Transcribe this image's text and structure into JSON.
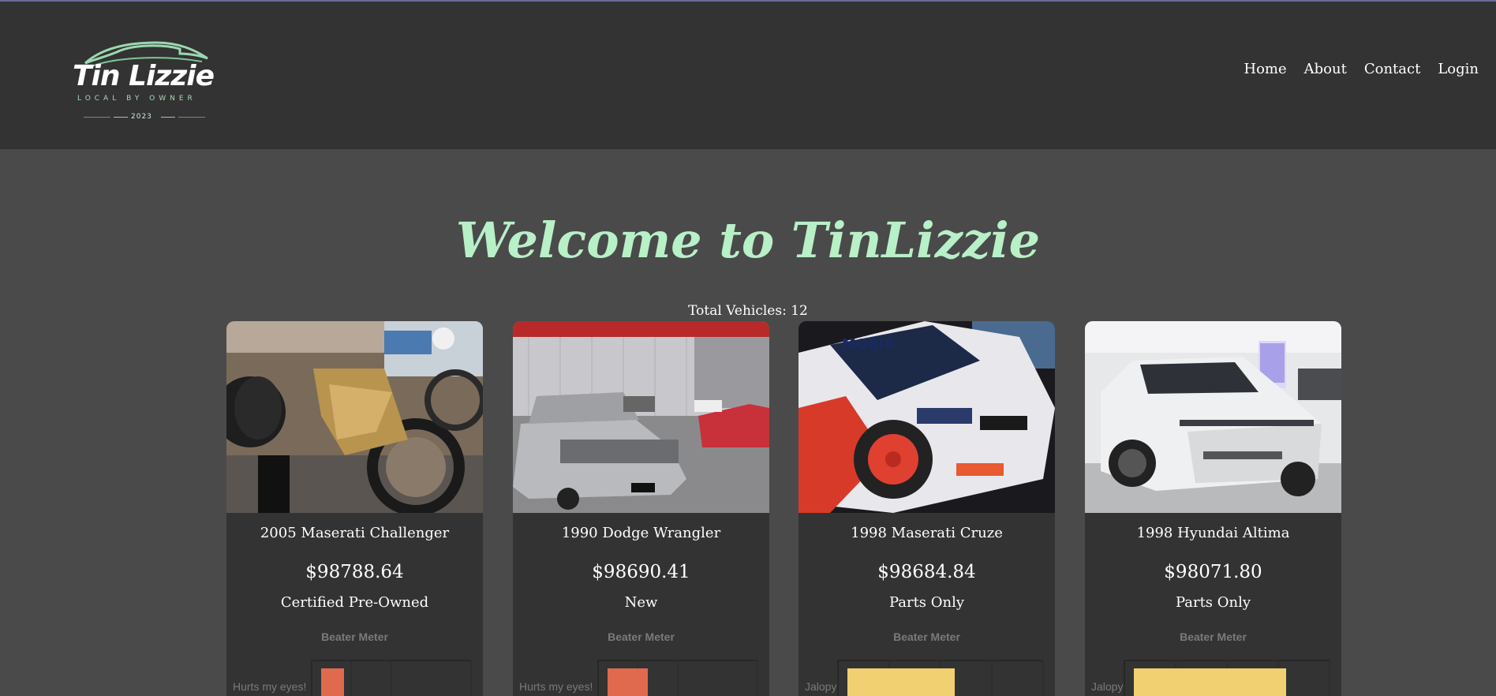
{
  "header": {
    "logo": {
      "name": "Tin Lizzie",
      "tagline": "LOCAL BY OWNER",
      "year": "2023"
    },
    "nav": [
      "Home",
      "About",
      "Contact",
      "Login"
    ]
  },
  "main": {
    "title": "Welcome to TinLizzie",
    "total": "Total Vehicles: 12"
  },
  "colors": {
    "accent": "#b8f0c8",
    "header_bg": "#333333",
    "page_bg": "#4a4a4a",
    "bar_red": "#e06a4e",
    "bar_yellow": "#f0d070"
  },
  "vehicles": [
    {
      "title": "2005 Maserati Challenger",
      "price": "$98788.64",
      "condition": "Certified Pre-Owned",
      "meter_title": "Beater Meter",
      "meter_label": "Hurts my eyes!",
      "meter_level": 0.15,
      "meter_color": "#e06a4e",
      "photo": "motorcycles-photo"
    },
    {
      "title": "1990 Dodge Wrangler",
      "price": "$98690.41",
      "condition": "New",
      "meter_title": "Beater Meter",
      "meter_label": "Hurts my eyes!",
      "meter_level": 0.27,
      "meter_color": "#e06a4e",
      "photo": "classic-sedan-photo"
    },
    {
      "title": "1998 Maserati Cruze",
      "price": "$98684.84",
      "condition": "Parts Only",
      "meter_title": "Beater Meter",
      "meter_label": "Jalopy",
      "meter_level": 0.55,
      "meter_color": "#f0d070",
      "photo": "rally-car-photo"
    },
    {
      "title": "1998 Hyundai Altima",
      "price": "$98071.80",
      "condition": "Parts Only",
      "meter_title": "Beater Meter",
      "meter_label": "Jalopy",
      "meter_level": 0.78,
      "meter_color": "#f0d070",
      "photo": "white-suv-photo"
    }
  ]
}
